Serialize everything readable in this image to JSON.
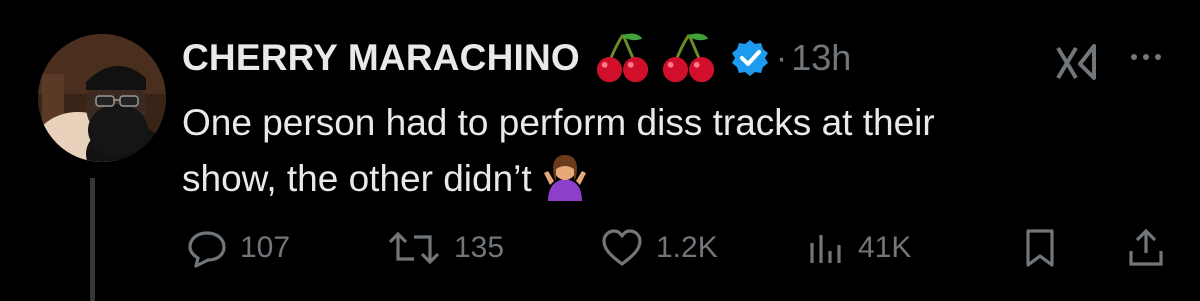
{
  "author": {
    "name": "CHERRY MARACHINO",
    "verified": true,
    "badge_icons": [
      "cherries-emoji",
      "cherries-emoji"
    ]
  },
  "tweet": {
    "time": "13h",
    "separator": "·",
    "text_line1": "One person had to perform diss tracks at their",
    "text_line2": "show, the other didn’t",
    "trailing_emoji": "person-shrugging-emoji"
  },
  "actions": {
    "replies": "107",
    "retweets": "135",
    "likes": "1.2K",
    "views": "41K"
  },
  "colors": {
    "background": "#000000",
    "text": "#e7e9ea",
    "muted": "#71767b",
    "verified_blue": "#1d9bf0",
    "thread_line": "#33363a"
  }
}
